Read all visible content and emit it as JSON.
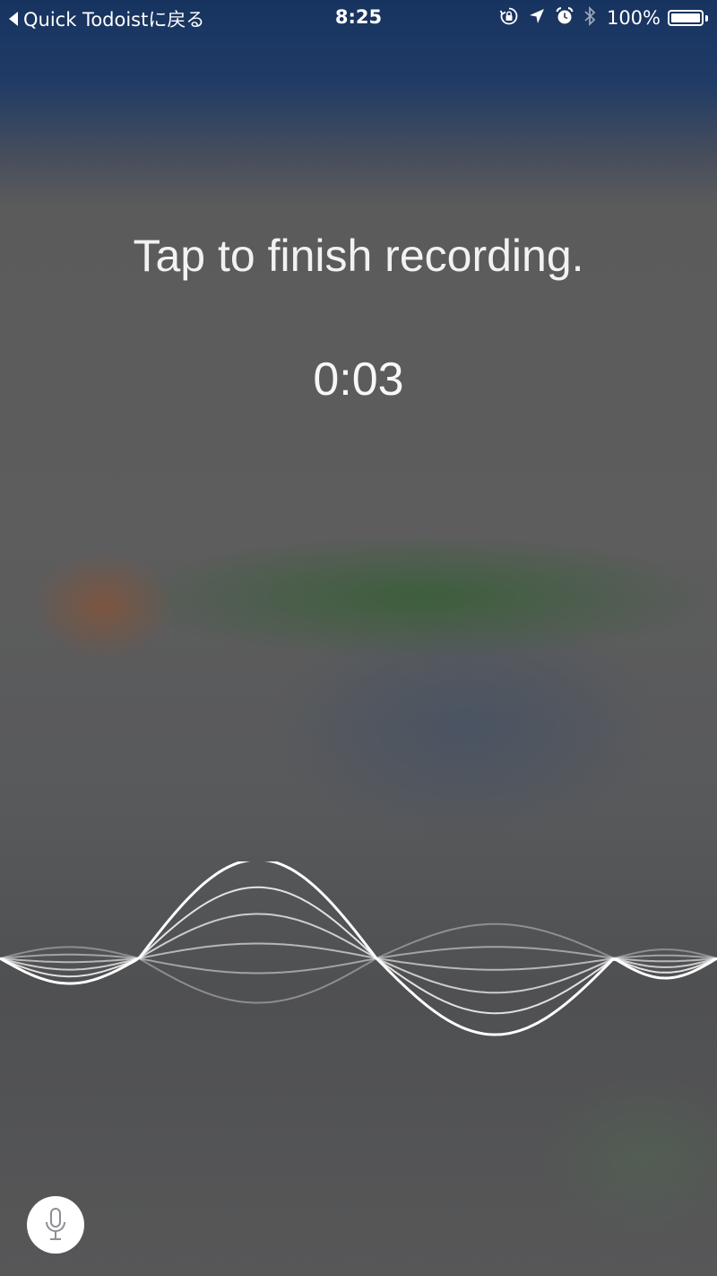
{
  "status_bar": {
    "back_label": "Quick Todoistに戻る",
    "time": "8:25",
    "battery_percent": "100%",
    "battery_level": 1.0,
    "icons": [
      "orientation-lock-icon",
      "location-arrow-icon",
      "alarm-icon",
      "bluetooth-icon",
      "battery-icon"
    ]
  },
  "recording": {
    "prompt": "Tap to finish recording.",
    "elapsed": "0:03"
  },
  "mic_button": {
    "icon": "microphone-icon"
  },
  "colors": {
    "text": "#ffffff",
    "top_tint": "#17335f",
    "background": "#5d5d5d"
  }
}
